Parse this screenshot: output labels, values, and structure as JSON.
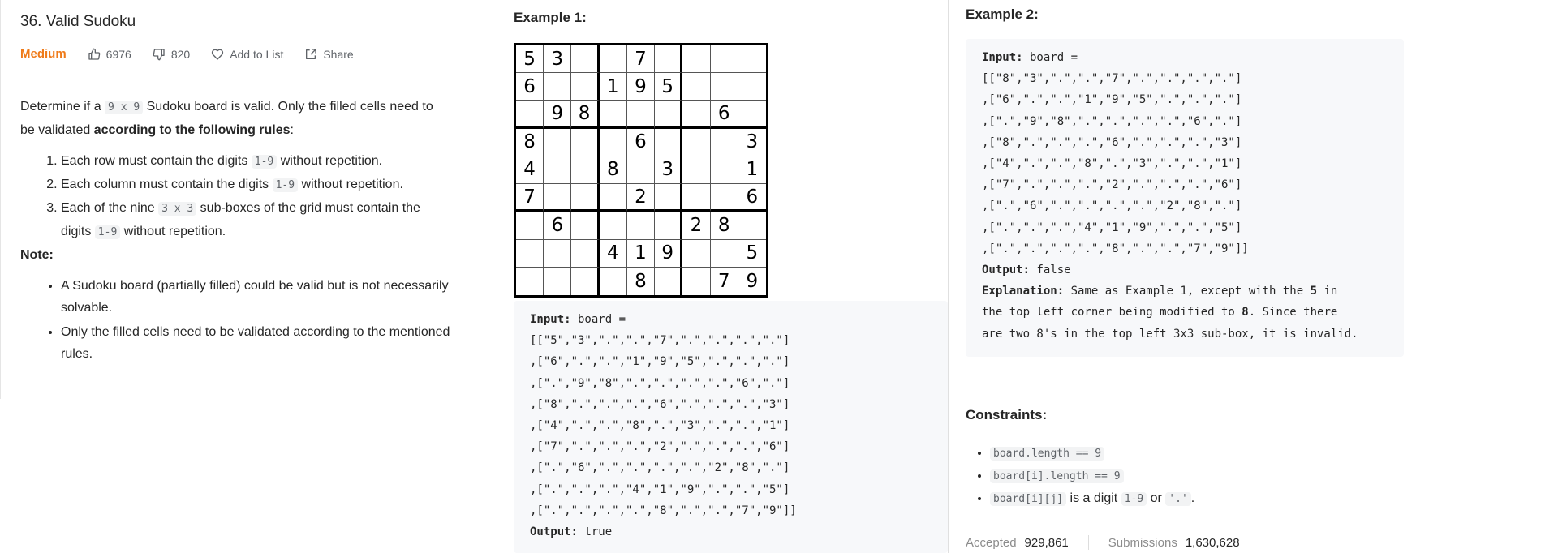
{
  "problem": {
    "title": "36. Valid Sudoku",
    "difficulty": "Medium",
    "likes": "6976",
    "dislikes": "820",
    "add_to_list": "Add to List",
    "share": "Share",
    "colors": {
      "difficulty": "#ef7b1a"
    }
  },
  "description": {
    "intro_pre": "Determine if a ",
    "intro_code": "9 x 9",
    "intro_mid": " Sudoku board is valid. Only the filled cells need to be validated ",
    "intro_bold": "according to the following rules",
    "intro_end": ":",
    "rules": [
      {
        "pre": "Each row must contain the digits ",
        "code": "1-9",
        "post": " without repetition."
      },
      {
        "pre": "Each column must contain the digits ",
        "code": "1-9",
        "post": " without repetition."
      },
      {
        "pre": "Each of the nine ",
        "code": "3 x 3",
        "post": " sub-boxes of the grid must contain the digits ",
        "code2": "1-9",
        "post2": " without repetition."
      }
    ],
    "note_label": "Note:",
    "notes": [
      "A Sudoku board (partially filled) could be valid but is not necessarily solvable.",
      "Only the filled cells need to be validated according to the mentioned rules."
    ]
  },
  "example1": {
    "heading": "Example 1:",
    "board": [
      [
        "5",
        "3",
        "",
        "",
        "7",
        "",
        "",
        "",
        ""
      ],
      [
        "6",
        "",
        "",
        "1",
        "9",
        "5",
        "",
        "",
        ""
      ],
      [
        "",
        "9",
        "8",
        "",
        "",
        "",
        "",
        "6",
        ""
      ],
      [
        "8",
        "",
        "",
        "",
        "6",
        "",
        "",
        "",
        "3"
      ],
      [
        "4",
        "",
        "",
        "8",
        "",
        "3",
        "",
        "",
        "1"
      ],
      [
        "7",
        "",
        "",
        "",
        "2",
        "",
        "",
        "",
        "6"
      ],
      [
        "",
        "6",
        "",
        "",
        "",
        "",
        "2",
        "8",
        ""
      ],
      [
        "",
        "",
        "",
        "4",
        "1",
        "9",
        "",
        "",
        "5"
      ],
      [
        "",
        "",
        "",
        "",
        "8",
        "",
        "",
        "7",
        "9"
      ]
    ],
    "input_label": "Input:",
    "input_first": " board =",
    "input_lines": [
      "[[\"5\",\"3\",\".\",\".\",\"7\",\".\",\".\",\".\",\".\"]",
      ",[\"6\",\".\",\".\",\"1\",\"9\",\"5\",\".\",\".\",\".\"]",
      ",[\".\",\"9\",\"8\",\".\",\".\",\".\",\".\",\"6\",\".\"]",
      ",[\"8\",\".\",\".\",\".\",\"6\",\".\",\".\",\".\",\"3\"]",
      ",[\"4\",\".\",\".\",\"8\",\".\",\"3\",\".\",\".\",\"1\"]",
      ",[\"7\",\".\",\".\",\".\",\"2\",\".\",\".\",\".\",\"6\"]",
      ",[\".\",\"6\",\".\",\".\",\".\",\".\",\"2\",\"8\",\".\"]",
      ",[\".\",\".\",\".\",\"4\",\"1\",\"9\",\".\",\".\",\"5\"]",
      ",[\".\",\".\",\".\",\".\",\"8\",\".\",\".\",\"7\",\"9\"]]"
    ],
    "output_label": "Output:",
    "output_value": " true"
  },
  "example2": {
    "heading": "Example 2:",
    "input_label": "Input:",
    "input_first": " board =",
    "input_lines": [
      "[[\"8\",\"3\",\".\",\".\",\"7\",\".\",\".\",\".\",\".\"]",
      ",[\"6\",\".\",\".\",\"1\",\"9\",\"5\",\".\",\".\",\".\"]",
      ",[\".\",\"9\",\"8\",\".\",\".\",\".\",\".\",\"6\",\".\"]",
      ",[\"8\",\".\",\".\",\".\",\"6\",\".\",\".\",\".\",\"3\"]",
      ",[\"4\",\".\",\".\",\"8\",\".\",\"3\",\".\",\".\",\"1\"]",
      ",[\"7\",\".\",\".\",\".\",\"2\",\".\",\".\",\".\",\"6\"]",
      ",[\".\",\"6\",\".\",\".\",\".\",\".\",\"2\",\"8\",\".\"]",
      ",[\".\",\".\",\".\",\"4\",\"1\",\"9\",\".\",\".\",\"5\"]",
      ",[\".\",\".\",\".\",\".\",\"8\",\".\",\".\",\"7\",\"9\"]]"
    ],
    "output_label": "Output:",
    "output_value": " false",
    "explanation_label": "Explanation:",
    "explanation_lines": [
      {
        "text": " Same as Example 1, except with the ",
        "bold": "5",
        "rest": " in"
      },
      {
        "text": "the top left corner being modified to ",
        "bold": "8",
        "rest": ". Since there"
      },
      {
        "text": "are two 8's in the top left 3x3 sub-box, it is invalid.",
        "bold": "",
        "rest": ""
      }
    ]
  },
  "constraints": {
    "heading": "Constraints:",
    "items": [
      {
        "code": "board.length == 9",
        "text": ""
      },
      {
        "code": "board[i].length == 9",
        "text": ""
      },
      {
        "code": "board[i][j]",
        "text": " is a digit ",
        "code2": "1-9",
        "text2": " or ",
        "code3": "'.'",
        "text3": "."
      }
    ]
  },
  "stats": {
    "accepted_label": "Accepted",
    "accepted_value": "929,861",
    "submissions_label": "Submissions",
    "submissions_value": "1,630,628"
  }
}
